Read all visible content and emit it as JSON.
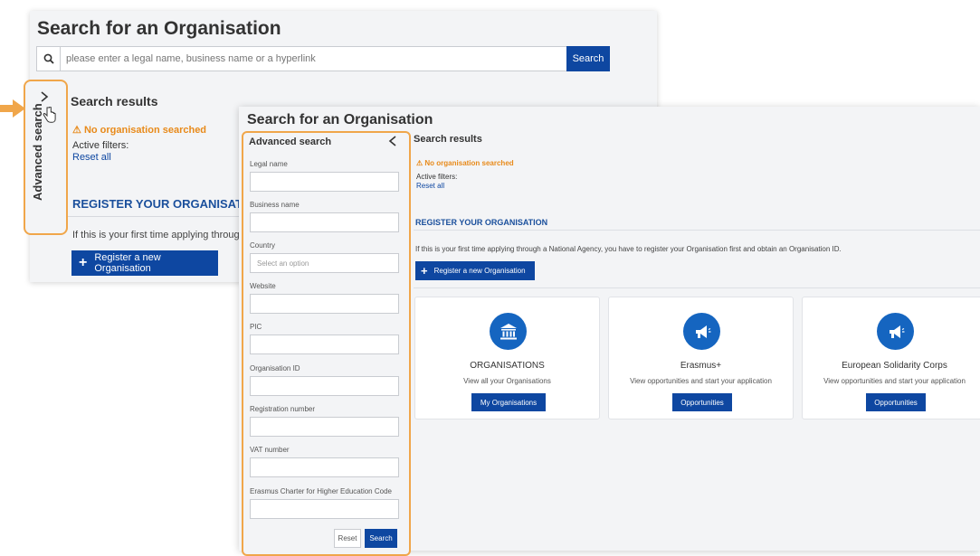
{
  "back": {
    "title": "Search for an Organisation",
    "search": {
      "placeholder": "please enter a legal name, business name or a hyperlink",
      "button": "Search"
    },
    "side_tab": {
      "label": "Advanced search"
    },
    "results": {
      "heading": "Search results",
      "warning": "No organisation searched",
      "active_filters": "Active filters:",
      "reset_all": "Reset all"
    },
    "register": {
      "heading": "REGISTER YOUR ORGANISATION",
      "intro": "If this is your first time applying through",
      "button": "Register a new Organisation"
    }
  },
  "front": {
    "title": "Search for an Organisation",
    "advanced": {
      "heading": "Advanced search",
      "fields": [
        {
          "label": "Legal name",
          "placeholder": ""
        },
        {
          "label": "Business name",
          "placeholder": ""
        },
        {
          "label": "Country",
          "placeholder": "Select an option"
        },
        {
          "label": "Website",
          "placeholder": ""
        },
        {
          "label": "PIC",
          "placeholder": ""
        },
        {
          "label": "Organisation ID",
          "placeholder": ""
        },
        {
          "label": "Registration number",
          "placeholder": ""
        },
        {
          "label": "VAT number",
          "placeholder": ""
        },
        {
          "label": "Erasmus Charter for Higher Education Code",
          "placeholder": ""
        }
      ],
      "reset_button": "Reset",
      "search_button": "Search"
    },
    "results": {
      "heading": "Search results",
      "warning": "No organisation searched",
      "active_filters": "Active filters:",
      "reset_all": "Reset all"
    },
    "register": {
      "heading": "REGISTER YOUR ORGANISATION",
      "intro": "If this is your first time applying through a National Agency, you have to register your Organisation first and obtain an Organisation ID.",
      "button": "Register a new Organisation"
    },
    "cards": [
      {
        "icon": "institution-icon",
        "title": "ORGANISATIONS",
        "subtitle": "View all your Organisations",
        "button": "My Organisations"
      },
      {
        "icon": "megaphone-icon",
        "title": "Erasmus+",
        "subtitle": "View opportunities and start your application",
        "button": "Opportunities"
      },
      {
        "icon": "megaphone-icon",
        "title": "European Solidarity Corps",
        "subtitle": "View opportunities and start your application",
        "button": "Opportunities"
      }
    ]
  },
  "colors": {
    "primary": "#0e47a1",
    "icon_circle": "#1565c0",
    "warning": "#e88a1a",
    "highlight": "#f0a64a",
    "heading_blue": "#1a4f9c"
  }
}
